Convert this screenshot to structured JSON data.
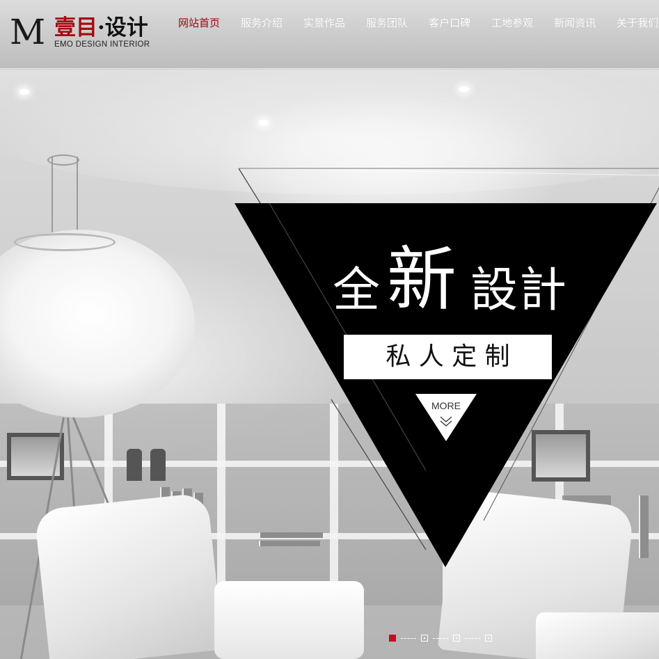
{
  "logo": {
    "mark": "M",
    "name_red": "壹目",
    "name_black": "·设计",
    "tagline": "EMO DESIGN INTERIOR"
  },
  "nav": {
    "items": [
      {
        "label": "网站首页",
        "active": true
      },
      {
        "label": "服务介绍",
        "active": false
      },
      {
        "label": "实景作品",
        "active": false
      },
      {
        "label": "服务团队",
        "active": false
      },
      {
        "label": "客户口碑",
        "active": false
      },
      {
        "label": "工地参观",
        "active": false
      },
      {
        "label": "新闻资讯",
        "active": false
      },
      {
        "label": "关于我们",
        "active": false
      }
    ]
  },
  "banner": {
    "headline_1": "全",
    "headline_2": "新",
    "headline_3": "設計",
    "subtitle": "私 人 定 制",
    "more_label": "MORE"
  },
  "slider": {
    "total": 4,
    "active_index": 0
  },
  "colors": {
    "accent": "#a50d12",
    "active_dot": "#c30d1d",
    "nav_text": "#ffffff",
    "triangle": "#000000"
  }
}
